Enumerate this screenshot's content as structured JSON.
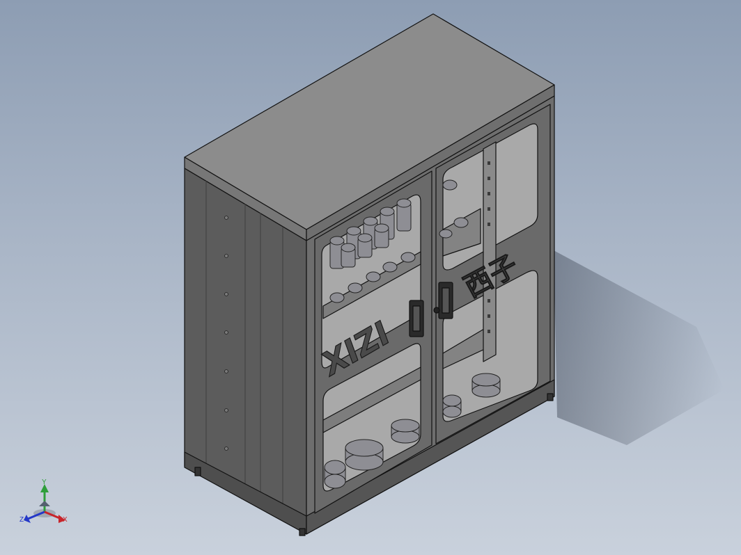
{
  "viewport": {
    "background_top": "#8d9db3",
    "background_bottom": "#c9d1dc"
  },
  "cabinet": {
    "left_door_brand": "XIZI",
    "right_door_brand": "西子",
    "body_color": "#6a6a6a",
    "top_color": "#8c8c8c",
    "side_color": "#5c5c5c",
    "window_color": "#a9a9a9",
    "tool_color": "#8e8e94"
  },
  "triad": {
    "y_label": "Y",
    "z_label": "Z",
    "x_label": "X",
    "y_color": "#2e9e3a",
    "z_color": "#2438c8",
    "x_color": "#c8242a"
  },
  "icons": {
    "triad": "view-orientation-triad-icon"
  }
}
